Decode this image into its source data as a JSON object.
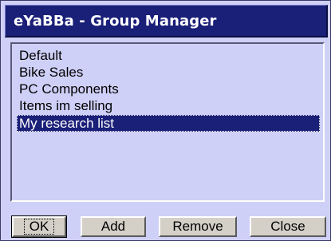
{
  "window": {
    "title": "eYaBBa - Group Manager"
  },
  "groups": {
    "items": [
      {
        "label": "Default",
        "selected": false
      },
      {
        "label": "Bike Sales",
        "selected": false
      },
      {
        "label": "PC Components",
        "selected": false
      },
      {
        "label": "Items im selling",
        "selected": false
      },
      {
        "label": "My research list",
        "selected": true
      }
    ]
  },
  "buttons": {
    "ok": "OK",
    "add": "Add",
    "remove": "Remove",
    "close": "Close"
  },
  "colors": {
    "background": "#cfd0f7",
    "titlebar": "#1a1f78",
    "selection": "#1a1f78",
    "button_face": "#d4d0c8"
  }
}
